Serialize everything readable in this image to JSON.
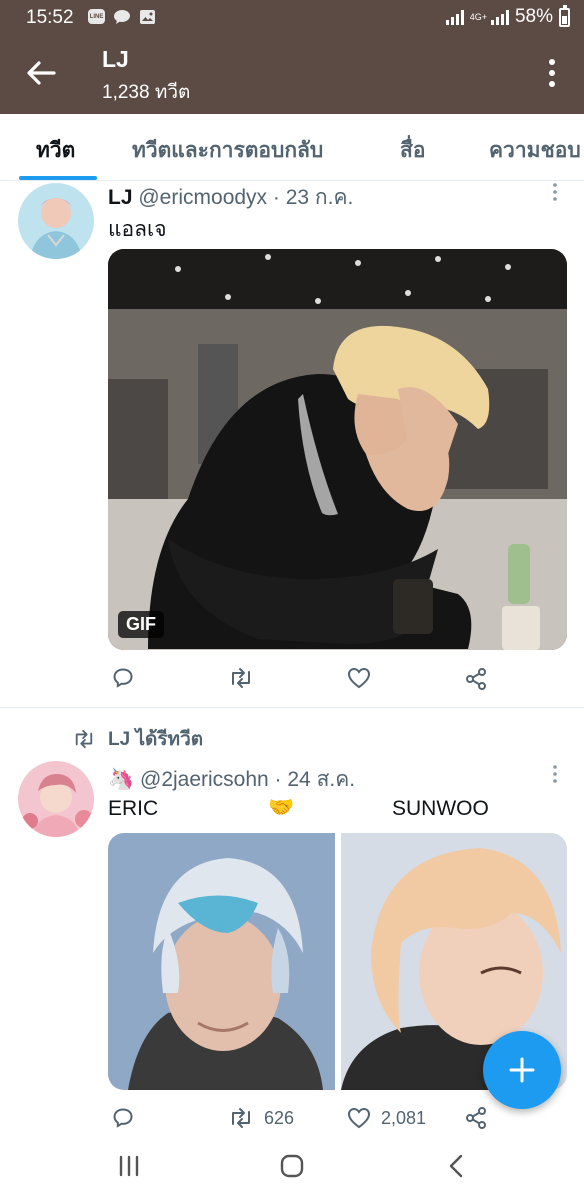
{
  "status_bar": {
    "time": "15:52",
    "notification_icons": [
      "line-icon",
      "chat-bubble-icon",
      "image-icon"
    ],
    "network_type": "4G+",
    "battery": "58%"
  },
  "header": {
    "display_name": "LJ",
    "tweet_count": "1,238 ทวีต"
  },
  "tabs": [
    {
      "label": "ทวีต",
      "active": true
    },
    {
      "label": "ทวีตและการตอบกลับ",
      "active": false
    },
    {
      "label": "สื่อ",
      "active": false
    },
    {
      "label": "ความชอบ",
      "active": false
    }
  ],
  "tweets": [
    {
      "author_name": "LJ",
      "handle_date": "@ericmoodyx · 23 ก.ค.",
      "text": "แอลเจ",
      "media_badge": "GIF",
      "actions": {
        "reply": "",
        "retweet": "",
        "like": "",
        "share": ""
      }
    },
    {
      "retweeted_by": "LJ ได้รีทวีต",
      "author_emoji": "🦄",
      "handle_date": "@2jaericsohn · 24 ส.ค.",
      "text_left": "ERIC",
      "text_emoji": "🤝",
      "text_right": "SUNWOO",
      "actions": {
        "reply": "",
        "retweet": "626",
        "like": "2,081",
        "share": ""
      }
    }
  ],
  "colors": {
    "header_bg": "#5b4b44",
    "accent": "#1d9bf0",
    "muted_text": "#536471"
  }
}
